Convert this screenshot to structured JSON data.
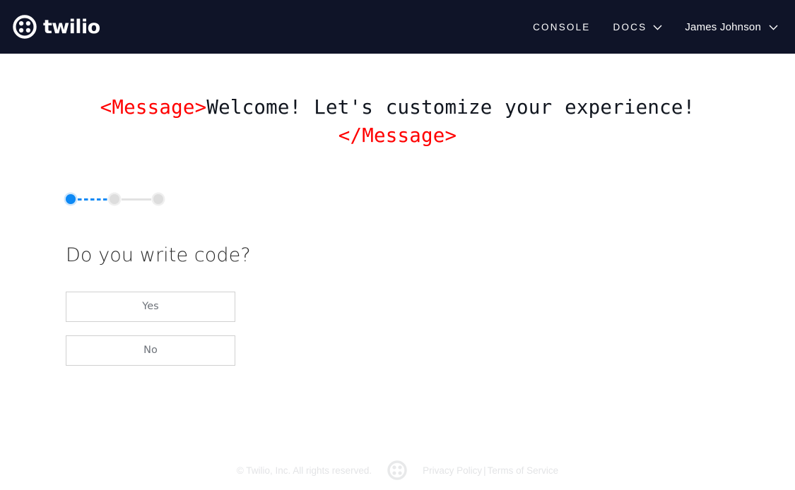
{
  "header": {
    "brand_name": "twilio",
    "brand_icon": "twilio-logo-mark",
    "nav": [
      {
        "label": "CONSOLE",
        "has_chevron": false
      },
      {
        "label": "DOCS",
        "has_chevron": true
      },
      {
        "label": "James Johnson",
        "has_chevron": true
      }
    ],
    "background_color": "#0f1428"
  },
  "hero": {
    "open_tag": "<Message>",
    "text": "Welcome! Let's customize your experience!",
    "close_tag": "</Message>",
    "tag_color": "#ff0000",
    "text_color": "#11161f"
  },
  "stepper": {
    "total_steps": 3,
    "current_step": 1,
    "active_color": "#0d89f5",
    "inactive_color": "#dddddd"
  },
  "form": {
    "question": "Do you write code?",
    "options": [
      {
        "label": "Yes"
      },
      {
        "label": "No"
      }
    ]
  },
  "footer": {
    "copyright": "© Twilio, Inc. All rights reserved.",
    "logo_icon": "twilio-logo-mark",
    "privacy_label": "Privacy Policy",
    "separator": "|",
    "terms_label": "Terms of Service",
    "text_color": "#e3e4e6"
  }
}
